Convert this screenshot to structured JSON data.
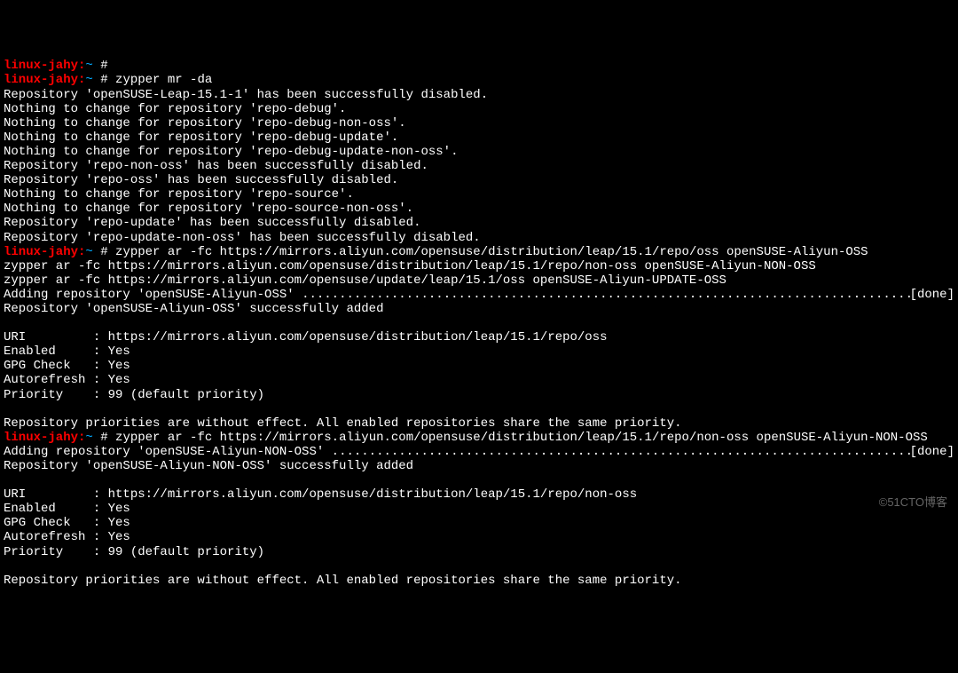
{
  "prompt": {
    "host": "linux-jahy:",
    "tilde": "~",
    "hash": " #"
  },
  "lines": [
    {
      "type": "prompt",
      "cmd": ""
    },
    {
      "type": "prompt",
      "cmd": " zypper mr -da"
    },
    {
      "type": "out",
      "text": "Repository 'openSUSE-Leap-15.1-1' has been successfully disabled."
    },
    {
      "type": "out",
      "text": "Nothing to change for repository 'repo-debug'."
    },
    {
      "type": "out",
      "text": "Nothing to change for repository 'repo-debug-non-oss'."
    },
    {
      "type": "out",
      "text": "Nothing to change for repository 'repo-debug-update'."
    },
    {
      "type": "out",
      "text": "Nothing to change for repository 'repo-debug-update-non-oss'."
    },
    {
      "type": "out",
      "text": "Repository 'repo-non-oss' has been successfully disabled."
    },
    {
      "type": "out",
      "text": "Repository 'repo-oss' has been successfully disabled."
    },
    {
      "type": "out",
      "text": "Nothing to change for repository 'repo-source'."
    },
    {
      "type": "out",
      "text": "Nothing to change for repository 'repo-source-non-oss'."
    },
    {
      "type": "out",
      "text": "Repository 'repo-update' has been successfully disabled."
    },
    {
      "type": "out",
      "text": "Repository 'repo-update-non-oss' has been successfully disabled."
    },
    {
      "type": "prompt",
      "cmd": " zypper ar -fc https://mirrors.aliyun.com/opensuse/distribution/leap/15.1/repo/oss openSUSE-Aliyun-OSS"
    },
    {
      "type": "out",
      "text": "zypper ar -fc https://mirrors.aliyun.com/opensuse/distribution/leap/15.1/repo/non-oss openSUSE-Aliyun-NON-OSS"
    },
    {
      "type": "out",
      "text": "zypper ar -fc https://mirrors.aliyun.com/opensuse/update/leap/15.1/oss openSUSE-Aliyun-UPDATE-OSS"
    },
    {
      "type": "done",
      "text": "Adding repository 'openSUSE-Aliyun-OSS' ",
      "done": "[done]"
    },
    {
      "type": "out",
      "text": "Repository 'openSUSE-Aliyun-OSS' successfully added"
    },
    {
      "type": "out",
      "text": ""
    },
    {
      "type": "out",
      "text": "URI         : https://mirrors.aliyun.com/opensuse/distribution/leap/15.1/repo/oss"
    },
    {
      "type": "out",
      "text": "Enabled     : Yes"
    },
    {
      "type": "out",
      "text": "GPG Check   : Yes"
    },
    {
      "type": "out",
      "text": "Autorefresh : Yes"
    },
    {
      "type": "out",
      "text": "Priority    : 99 (default priority)"
    },
    {
      "type": "out",
      "text": ""
    },
    {
      "type": "out",
      "text": "Repository priorities are without effect. All enabled repositories share the same priority."
    },
    {
      "type": "prompt",
      "cmd": " zypper ar -fc https://mirrors.aliyun.com/opensuse/distribution/leap/15.1/repo/non-oss openSUSE-Aliyun-NON-OSS"
    },
    {
      "type": "done",
      "text": "Adding repository 'openSUSE-Aliyun-NON-OSS' ",
      "done": "[done]"
    },
    {
      "type": "out",
      "text": "Repository 'openSUSE-Aliyun-NON-OSS' successfully added"
    },
    {
      "type": "out",
      "text": ""
    },
    {
      "type": "out",
      "text": "URI         : https://mirrors.aliyun.com/opensuse/distribution/leap/15.1/repo/non-oss"
    },
    {
      "type": "out",
      "text": "Enabled     : Yes"
    },
    {
      "type": "out",
      "text": "GPG Check   : Yes"
    },
    {
      "type": "out",
      "text": "Autorefresh : Yes"
    },
    {
      "type": "out",
      "text": "Priority    : 99 (default priority)"
    },
    {
      "type": "out",
      "text": ""
    },
    {
      "type": "out",
      "text": "Repository priorities are without effect. All enabled repositories share the same priority."
    }
  ],
  "watermark": "©51CTO博客"
}
